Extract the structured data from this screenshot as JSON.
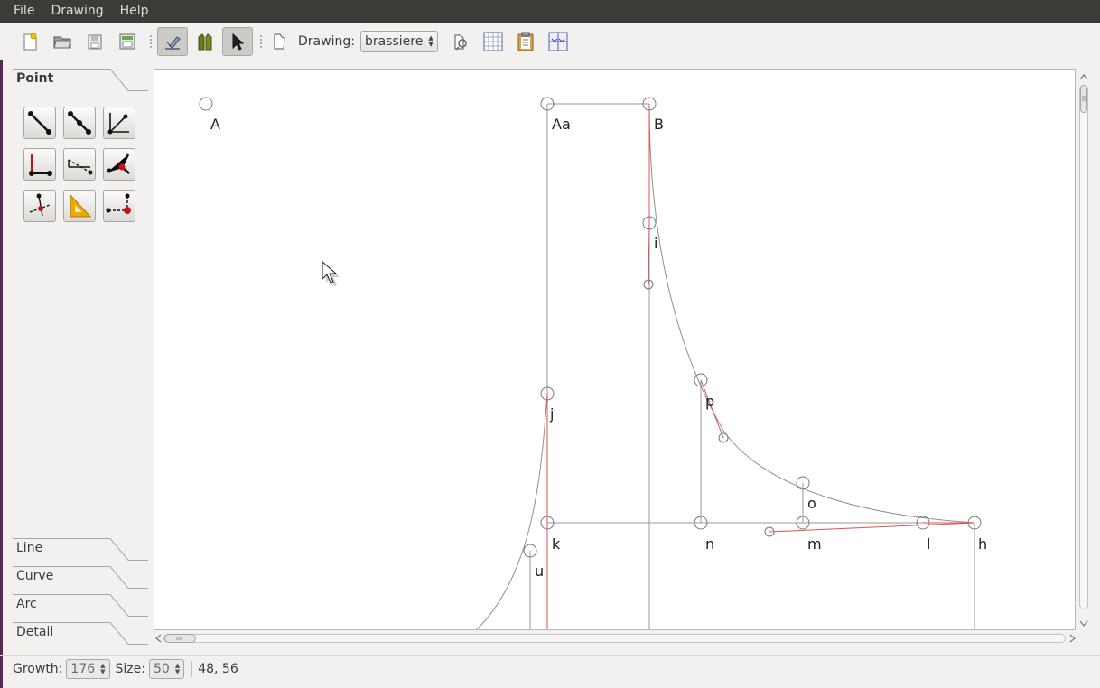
{
  "menubar": {
    "items": [
      "File",
      "Drawing",
      "Help"
    ]
  },
  "toolbar": {
    "drawing_label": "Drawing:",
    "drawing_value": "brassiere",
    "icons": [
      "new-file-icon",
      "open-file-icon",
      "save-file-icon",
      "save-as-icon",
      "draw-mode-icon",
      "details-mode-icon",
      "pointer-icon",
      "new-drawing-icon",
      "option-draw-icon",
      "table-of-variables-icon",
      "history-icon",
      "layout-icon"
    ]
  },
  "toolbox": {
    "sections": {
      "point": "Point",
      "line": "Line",
      "curve": "Curve",
      "arc": "Arc",
      "detail": "Detail"
    },
    "point_tools": [
      "line-point-tool",
      "along-line-tool",
      "normal-tool",
      "bisector-tool",
      "shoulder-point-tool",
      "normal-to-point-tool",
      "height-tool",
      "triangle-tool",
      "point-of-contact-tool"
    ]
  },
  "canvas": {
    "points": [
      "A",
      "Aa",
      "B",
      "i",
      "j",
      "p",
      "o",
      "k",
      "n",
      "m",
      "l",
      "h",
      "u"
    ]
  },
  "statusbar": {
    "growth_label": "Growth:",
    "growth_value": "176",
    "size_label": "Size:",
    "size_value": "50",
    "coords": "48, 56"
  },
  "colors": {
    "menubar_bg": "#3c3b37",
    "line_gray": "#9a9a9a",
    "line_red": "#e05050"
  }
}
